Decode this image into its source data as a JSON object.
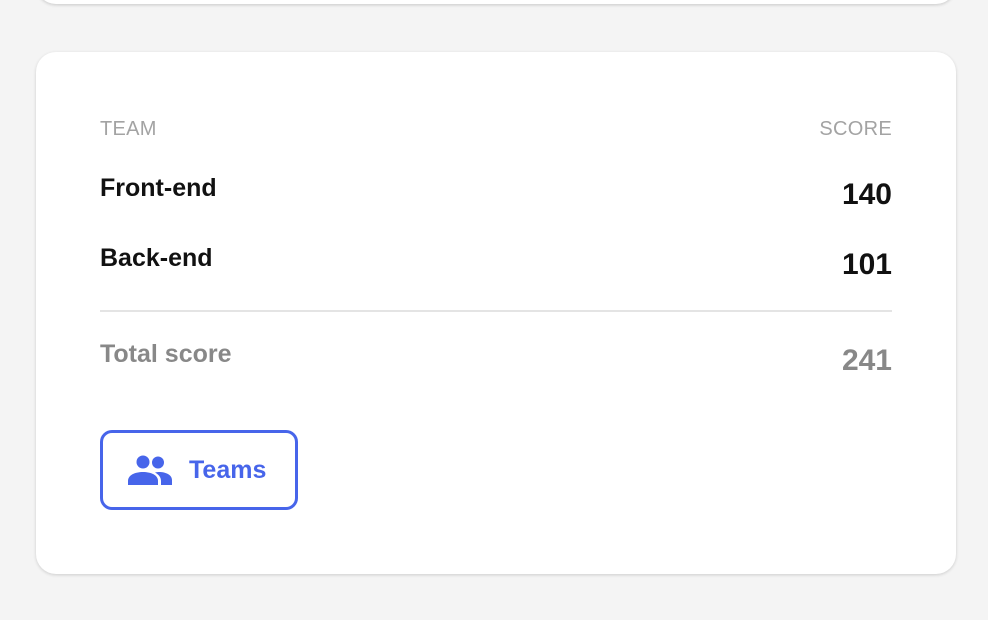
{
  "table": {
    "headers": {
      "team": "TEAM",
      "score": "SCORE"
    },
    "rows": [
      {
        "team": "Front-end",
        "score": "140"
      },
      {
        "team": "Back-end",
        "score": "101"
      }
    ],
    "total": {
      "label": "Total score",
      "value": "241"
    }
  },
  "teams_button": {
    "label": "Teams",
    "icon": "people-group-icon"
  },
  "colors": {
    "accent": "#4765ea",
    "text": "#111111",
    "muted": "#888888",
    "header": "#a3a3a3",
    "background": "#f4f4f4",
    "card": "#ffffff"
  }
}
